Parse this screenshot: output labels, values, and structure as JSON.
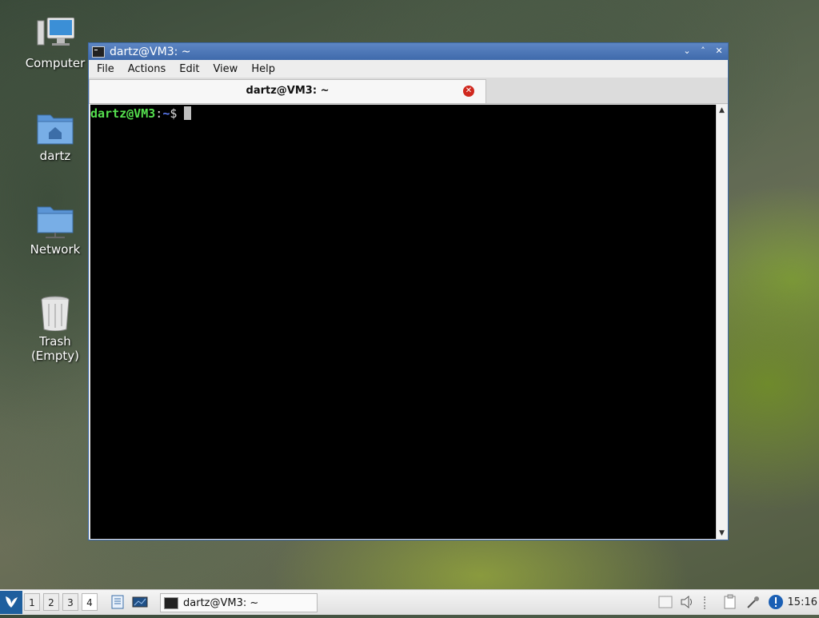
{
  "desktop": {
    "icons": [
      {
        "label": "Computer",
        "icon": "computer-icon"
      },
      {
        "label": "dartz",
        "icon": "home-folder-icon"
      },
      {
        "label": "Network",
        "icon": "network-folder-icon"
      },
      {
        "label": "Trash",
        "label2": "(Empty)",
        "icon": "trash-icon"
      }
    ]
  },
  "window": {
    "title": "dartz@VM3: ~",
    "menu": [
      "File",
      "Actions",
      "Edit",
      "View",
      "Help"
    ],
    "tab_label": "dartz@VM3: ~",
    "prompt": {
      "user_host": "dartz@VM3",
      "sep": ":",
      "path": "~",
      "symbol": "$"
    },
    "controls": [
      "minimize",
      "maximize",
      "close"
    ]
  },
  "taskbar": {
    "workspaces": [
      "1",
      "2",
      "3",
      "4"
    ],
    "task_label": "dartz@VM3: ~",
    "clock": "15:16"
  }
}
